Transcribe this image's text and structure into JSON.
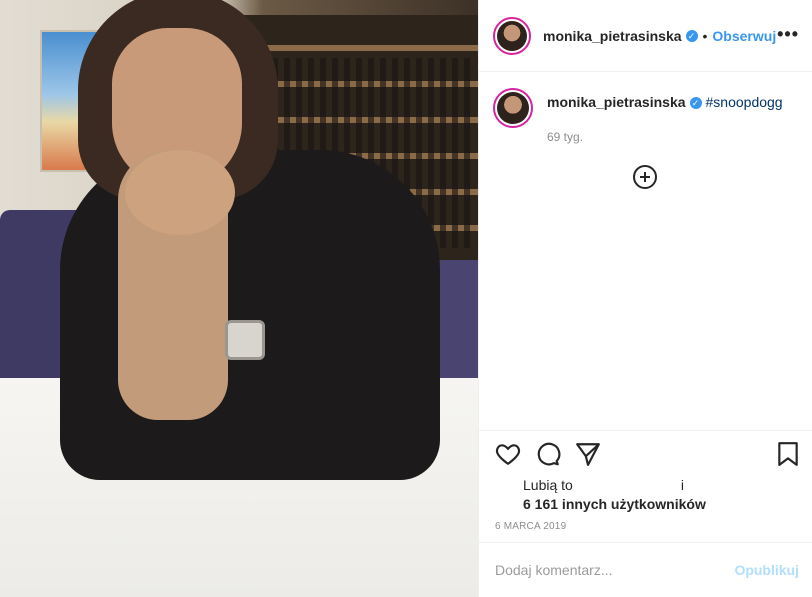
{
  "post": {
    "username": "monika_pietrasinska",
    "verified": true,
    "follow_label": "Obserwuj",
    "more_label": "•••",
    "caption_username": "monika_pietrasinska",
    "caption_hashtag": "#snoopdogg",
    "time_ago": "69 tyg.",
    "likes_prefix": "Lubią to",
    "likes_suffix": "i",
    "likes_count": "6 161 innych użytkowników",
    "date": "6 MARCA 2019",
    "comment_placeholder": "Dodaj komentarz...",
    "publish_label": "Opublikuj"
  },
  "icons": {
    "heart": "heart-icon",
    "comment": "comment-icon",
    "share": "share-icon",
    "bookmark": "bookmark-icon",
    "add": "add-circle-icon"
  },
  "colors": {
    "follow": "#3897f0",
    "publish": "#b2dffc",
    "verified": "#3897f0",
    "hashtag": "#003569"
  }
}
